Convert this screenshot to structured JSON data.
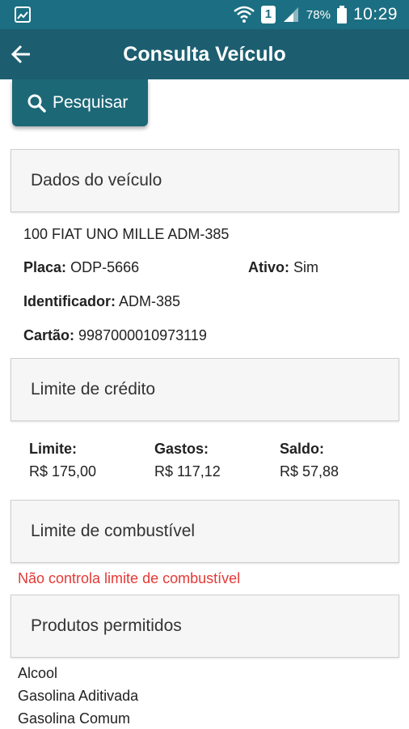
{
  "status_bar": {
    "sim_badge": "1",
    "battery_percent": "78%",
    "time": "10:29"
  },
  "app_bar": {
    "title": "Consulta Veículo"
  },
  "search_button": {
    "label": "Pesquisar"
  },
  "vehicle": {
    "section_title": "Dados do veículo",
    "description": "100 FIAT UNO MILLE ADM-385",
    "plate_label": "Placa:",
    "plate_value": "ODP-5666",
    "active_label": "Ativo:",
    "active_value": "Sim",
    "identifier_label": "Identificador:",
    "identifier_value": "ADM-385",
    "card_label": "Cartão:",
    "card_value": "9987000010973119"
  },
  "credit": {
    "section_title": "Limite de crédito",
    "limit_label": "Limite:",
    "limit_value": "R$ 175,00",
    "spent_label": "Gastos:",
    "spent_value": "R$ 117,12",
    "balance_label": "Saldo:",
    "balance_value": "R$ 57,88"
  },
  "fuel": {
    "section_title": "Limite de combustível",
    "message": "Não controla limite de combustível",
    "message_color": "#e53935"
  },
  "products": {
    "section_title": "Produtos permitidos",
    "items": [
      "Alcool",
      "Gasolina Aditivada",
      "Gasolina Comum"
    ]
  },
  "colors": {
    "status_bar": "#1c6f82",
    "app_bar": "#1c5e70",
    "button": "#1c6877"
  }
}
